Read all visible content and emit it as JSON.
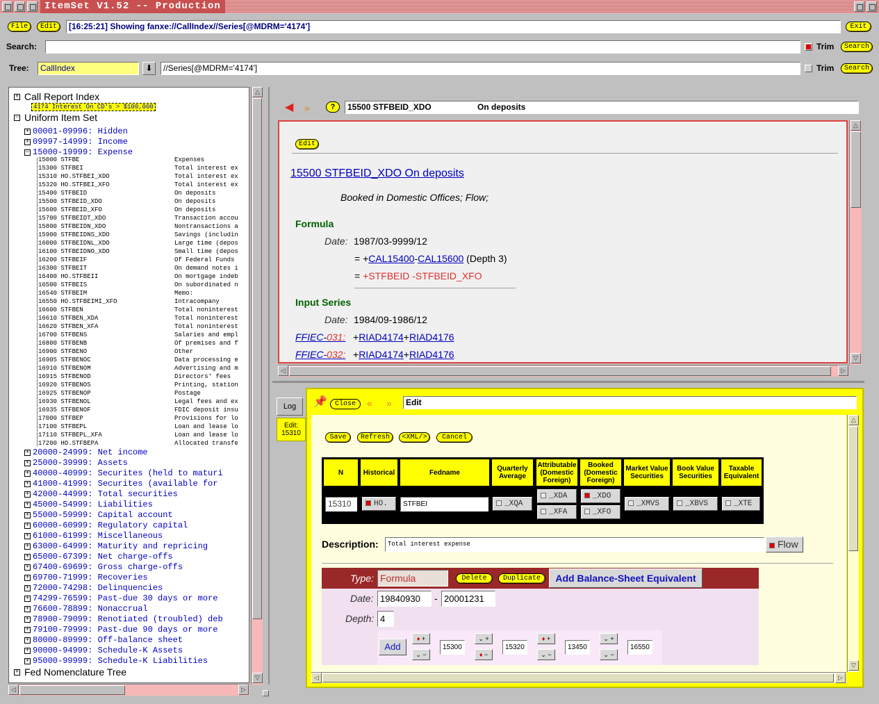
{
  "window": {
    "title": "ItemSet V1.52 -- Production"
  },
  "menu": {
    "file": "File",
    "edit": "Edit",
    "exit": "Exit"
  },
  "status": "[16:25:21] Showing fanxe://CallIndex//Series[@MDRM='4174']",
  "search": {
    "label": "Search:",
    "value": "",
    "trim": "Trim",
    "button": "Search"
  },
  "tree_bar": {
    "label": "Tree:",
    "select": "CallIndex",
    "query": "//Series[@MDRM='4174']",
    "trim": "Trim",
    "button": "Search"
  },
  "tree": {
    "call_report": "Call Report Index",
    "call_report_child": "4174 Interest On CD's > $100,000",
    "uniform": "Uniform Item Set",
    "ranges_top": [
      "00001-09996: Hidden",
      "09997-14999: Income",
      "15000-19999: Expense"
    ],
    "items": [
      {
        "c": "15000 STFBE",
        "d": "Expenses"
      },
      {
        "c": "15300 STFBEI",
        "d": "Total interest ex"
      },
      {
        "c": "15310 HO.STFBEI_XDO",
        "d": "Total interest ex"
      },
      {
        "c": "15320 HO.STFBEI_XFO",
        "d": "Total interest ex"
      },
      {
        "c": "15400 STFBEID",
        "d": "On deposits"
      },
      {
        "c": "15500 STFBEID_XDO",
        "d": "On deposits"
      },
      {
        "c": "15600 STFBEID_XFO",
        "d": "On deposits"
      },
      {
        "c": "15700 STFBEIDT_XDO",
        "d": "Transaction accou"
      },
      {
        "c": "15800 STFBEIDN_XDO",
        "d": "Nontransactions a"
      },
      {
        "c": "15900 STFBEIDNS_XDO",
        "d": "Savings (includin"
      },
      {
        "c": "16000 STFBEIDNL_XDO",
        "d": "Large time (depos"
      },
      {
        "c": "16100 STFBEIDNO_XDO",
        "d": "Small time (depos"
      },
      {
        "c": "16200 STFBEIF",
        "d": "Of Federal Funds"
      },
      {
        "c": "16300 STFBEIT",
        "d": "On demand notes i"
      },
      {
        "c": "16400 HO.STFBEII",
        "d": "On mortgage indeb"
      },
      {
        "c": "16500 STFBEIS",
        "d": "On subordinated n"
      },
      {
        "c": "16540 STFBEIM",
        "d": "Memo:"
      },
      {
        "c": "16550 HO.STFBEIMI_XFO",
        "d": "Intracompany"
      },
      {
        "c": "16600 STFBEN",
        "d": "Total noninterest"
      },
      {
        "c": "16610 STFBEN_XDA",
        "d": "Total noninterest"
      },
      {
        "c": "16620 STFBEN_XFA",
        "d": "Total noninterest"
      },
      {
        "c": "16700 STFBENS",
        "d": "Salaries and empl"
      },
      {
        "c": "16800 STFBENB",
        "d": "Of premises and f"
      },
      {
        "c": "16900 STFBENO",
        "d": "Other"
      },
      {
        "c": "16905 STFBENOC",
        "d": "Data processing e"
      },
      {
        "c": "16910 STFBENOM",
        "d": "Advertising and m"
      },
      {
        "c": "16915 STFBENOD",
        "d": "Directors' fees"
      },
      {
        "c": "16920 STFBENOS",
        "d": "Printing, station"
      },
      {
        "c": "16925 STFBENOP",
        "d": "Postage"
      },
      {
        "c": "16930 STFBENOL",
        "d": "Legal fees and ex"
      },
      {
        "c": "16935 STFBENOF",
        "d": "FDIC deposit insu"
      },
      {
        "c": "17000 STFBEP",
        "d": "Provisions for lo"
      },
      {
        "c": "17100 STFBEPL",
        "d": "Loan and lease lo"
      },
      {
        "c": "17110 STFBEPL_XFA",
        "d": "Loan and lease lo"
      },
      {
        "c": "17200 HO.STFBEPA",
        "d": "Allocated transfe"
      }
    ],
    "ranges_bottom": [
      "20000-24999: Net income",
      "25000-39999: Assets",
      "40000-40999: Securites (held to maturi",
      "41000-41999: Securites (available for",
      "42000-44999: Total securities",
      "45000-54999: Liabilities",
      "55000-59999: Capital account",
      "60000-60999: Regulatory capital",
      "61000-61999: Miscellaneous",
      "63000-64999: Maturity and repricing",
      "65000-67399: Net charge-offs",
      "67400-69699: Gross charge-offs",
      "69700-71999: Recoveries",
      "72000-74298: Delinquencies",
      "74299-76599: Past-due 30 days or more",
      "76600-78899: Nonaccrual",
      "78900-79099: Renotiated (troubled) deb",
      "79100-79999: Past-due 90 days or more",
      "80000-89999: Off-balance sheet",
      "90000-94999: Schedule-K Assets",
      "95000-99999: Schedule-K Liabilities"
    ],
    "fed_nomenclature": "Fed Nomenclature Tree"
  },
  "nav": {
    "field": "15500 STFBEID_XDO",
    "desc": "On deposits",
    "help": "?"
  },
  "detail": {
    "edit": "Edit",
    "heading": "15500 STFBEID_XDO On deposits",
    "subtitle": "Booked in Domestic Offices; Flow;",
    "formula_label": "Formula",
    "date_label": "Date:",
    "formula_date": "1987/03-9999/12",
    "eq1": "=",
    "f_plus": "+",
    "f_link1": "CAL15400",
    "f_dash": "-",
    "f_link2": "CAL15600",
    "f_depth": "(Depth 3)",
    "eq2": "=",
    "f_expr": "+STFBEID -STFBEID_XFO",
    "input_label": "Input Series",
    "input_date": "1984/09-1986/12",
    "src1": "FFIEC-",
    "src1b": "031:",
    "src2": "FFIEC-",
    "src2b": "032:",
    "r_plus": "+",
    "r_link1": "RIAD4174",
    "r_link2": "RIAD4176"
  },
  "tabs": {
    "log": "Log",
    "edit": "Edit:",
    "edit_id": "15310"
  },
  "editor": {
    "close": "Close",
    "title": "Edit",
    "save": "Save",
    "refresh": "Refresh",
    "xml": "<XML/>",
    "cancel": "Cancel",
    "headers": [
      "N",
      "Historical",
      "Fedname",
      "Quarterly Average",
      "Attributable (Domestic Foreign)",
      "Booked (Domestic Foreign)",
      "Market Value Securities",
      "Book Value Securities",
      "Taxable Equivalent"
    ],
    "n_value": "15310",
    "historical": "HO.",
    "fedname": "STFBEI",
    "xqa": "_XQA",
    "xda": "_XDA",
    "xfa": "_XFA",
    "xdo": "_XDO",
    "xfo": "_XFO",
    "xmvs": "_XMVS",
    "xbvs": "_XBVS",
    "xte": "_XTE",
    "desc_label": "Description:",
    "desc_value": "Total interest expense",
    "flow": "Flow",
    "type_label": "Type:",
    "type_value": "Formula",
    "delete": "Delete",
    "duplicate": "Duplicate",
    "add_bse": "Add Balance-Sheet Equivalent",
    "date_label": "Date:",
    "date_from": "19840930",
    "date_sep": "-",
    "date_to": "20001231",
    "depth_label": "Depth:",
    "depth_value": "4",
    "add": "Add",
    "terms": [
      "15300",
      "15320",
      "13450",
      "16550"
    ]
  },
  "colors": {
    "accent": "#ffff00",
    "title_bar": "#c85050",
    "type_bar": "#9a2828",
    "link": "#0000c0",
    "section": "#006000",
    "formula_red": "#e03030"
  }
}
